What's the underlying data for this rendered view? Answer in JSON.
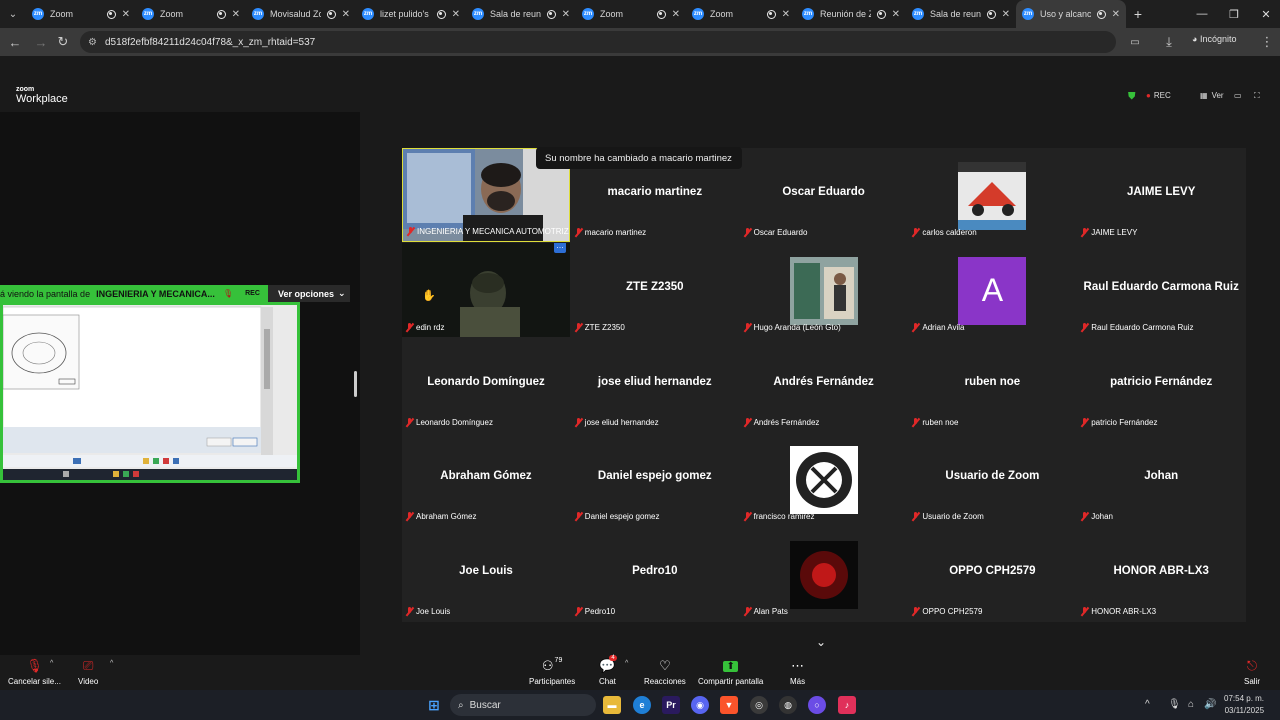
{
  "browser": {
    "tabs": [
      {
        "label": "Zoom",
        "favicon": "zoom-icon"
      },
      {
        "label": "Zoom",
        "favicon": "zoom-icon"
      },
      {
        "label": "Movisalud Zo",
        "favicon": "zoom-icon"
      },
      {
        "label": "lizet pulido's",
        "favicon": "zoom-icon"
      },
      {
        "label": "Sala de reunione",
        "favicon": "zoom-icon"
      },
      {
        "label": "Zoom",
        "favicon": "zoom-icon"
      },
      {
        "label": "Zoom",
        "favicon": "zoom-icon"
      },
      {
        "label": "Reunión de Z",
        "favicon": "zoom-icon"
      },
      {
        "label": "Sala de reunione",
        "favicon": "zoom-icon"
      },
      {
        "label": "Uso y alcance",
        "favicon": "zoom-icon",
        "active": true
      }
    ],
    "new_tab": "+",
    "address": "d518f2efbf84211d24c04f78&_x_zm_rhtaid=537",
    "incognito_label": "Incógnito"
  },
  "zoom_header": {
    "logo_top": "zoom",
    "logo_bottom": "Workplace",
    "rec_label": "REC",
    "view_label": "Ver"
  },
  "share": {
    "banner_prefix": "á viendo la pantalla de",
    "presenter_name": "INGENIERIA Y MECANICA...",
    "rec_label": "REC",
    "options_label": "Ver opciones"
  },
  "toast": "Su nombre ha cambiado a macario martinez",
  "participants": [
    {
      "display": "video",
      "label": "INGENIERIA Y MECANICA AUTOMOTRIZ",
      "speaker": true
    },
    {
      "display": "macario martinez",
      "label": "macario martinez"
    },
    {
      "display": "Oscar Eduardo",
      "label": "Oscar Eduardo"
    },
    {
      "display": "picture",
      "label": "carlos calderon"
    },
    {
      "display": "JAIME LEVY",
      "label": "JAIME LEVY"
    },
    {
      "display": "video",
      "label": "edin rdz"
    },
    {
      "display": "ZTE Z2350",
      "label": "ZTE Z2350"
    },
    {
      "display": "picture",
      "label": "Hugo Aranda (León Gto)"
    },
    {
      "display": "A",
      "label": "Adrian Avila"
    },
    {
      "display": "Raul Eduardo Carmona Ruiz",
      "label": "Raul Eduardo Carmona Ruiz"
    },
    {
      "display": "Leonardo Domínguez",
      "label": "Leonardo Domínguez"
    },
    {
      "display": "jose eliud hernandez",
      "label": "jose eliud hernandez"
    },
    {
      "display": "Andrés Fernández",
      "label": "Andrés Fernández"
    },
    {
      "display": "ruben noe",
      "label": "ruben noe"
    },
    {
      "display": "patricio Fernández",
      "label": "patricio Fernández"
    },
    {
      "display": "Abraham Gómez",
      "label": "Abraham Gómez"
    },
    {
      "display": "Daniel espejo gomez",
      "label": "Daniel espejo gomez"
    },
    {
      "display": "picture",
      "label": "francisco ramirez"
    },
    {
      "display": "Usuario de Zoom",
      "label": "Usuario de Zoom"
    },
    {
      "display": "Johan",
      "label": "Johan"
    },
    {
      "display": "Joe Louis",
      "label": "Joe Louis"
    },
    {
      "display": "Pedro10",
      "label": "Pedro10"
    },
    {
      "display": "picture",
      "label": "Alan Pats"
    },
    {
      "display": "OPPO CPH2579",
      "label": "OPPO CPH2579"
    },
    {
      "display": "HONOR ABR-LX3",
      "label": "HONOR ABR-LX3"
    }
  ],
  "toolbar": {
    "mute_label": "Cancelar sile...",
    "video_label": "Video",
    "participants_label": "Participantes",
    "participants_count": "79",
    "chat_label": "Chat",
    "chat_badge": "4",
    "reactions_label": "Reacciones",
    "share_label": "Compartir pantalla",
    "more_label": "Más",
    "leave_label": "Salir"
  },
  "taskbar": {
    "search_label": "Buscar",
    "time": "07:54 p. m.",
    "date": "03/11/2025"
  },
  "colors": {
    "share_green": "#36c13a",
    "mute_red": "#e02828",
    "avatar_purple": "#8a35c8",
    "zoom_blue": "#2d8cff"
  }
}
